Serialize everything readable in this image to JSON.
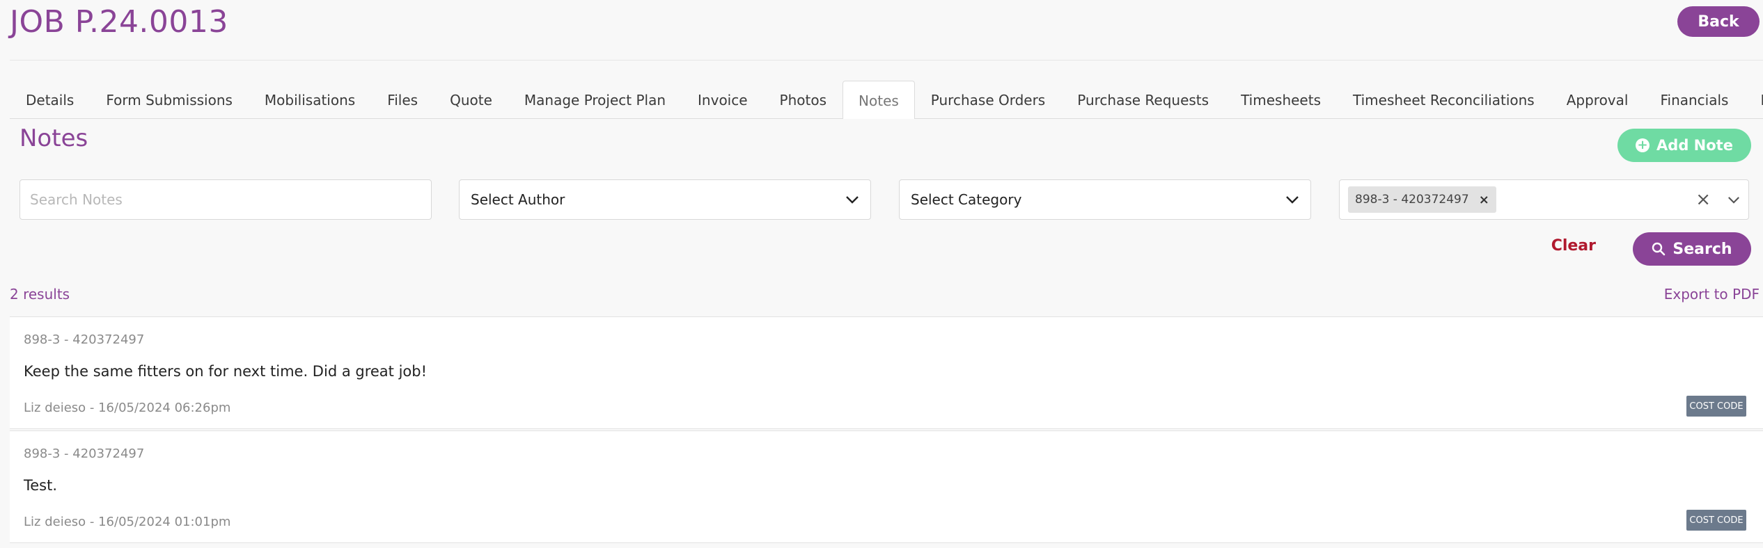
{
  "header": {
    "title": "JOB P.24.0013",
    "back_label": "Back"
  },
  "tabs": [
    {
      "label": "Details"
    },
    {
      "label": "Form Submissions"
    },
    {
      "label": "Mobilisations"
    },
    {
      "label": "Files"
    },
    {
      "label": "Quote"
    },
    {
      "label": "Manage Project Plan"
    },
    {
      "label": "Invoice"
    },
    {
      "label": "Photos"
    },
    {
      "label": "Notes",
      "active": true
    },
    {
      "label": "Purchase Orders"
    },
    {
      "label": "Purchase Requests"
    },
    {
      "label": "Timesheets"
    },
    {
      "label": "Timesheet Reconciliations"
    },
    {
      "label": "Approval"
    },
    {
      "label": "Financials"
    },
    {
      "label": "Receipts"
    }
  ],
  "notes_panel": {
    "heading": "Notes",
    "add_note_label": "Add Note",
    "filters": {
      "search_placeholder": "Search Notes",
      "search_value": "",
      "author_select": "Select Author",
      "category_select": "Select Category",
      "cost_code_chip": "898-3 - 420372497"
    },
    "clear_label": "Clear",
    "search_label": "Search",
    "results_count": "2 results",
    "export_label": "Export to PDF",
    "notes": [
      {
        "cost_code": "898-3 - 420372497",
        "text": "Keep the same fitters on for next time. Did a great job!",
        "meta": "Liz deieso - 16/05/2024 06:26pm",
        "badge": "COST CODE"
      },
      {
        "cost_code": "898-3 - 420372497",
        "text": "Test.",
        "meta": "Liz deieso - 16/05/2024 01:01pm",
        "badge": "COST CODE"
      }
    ]
  },
  "colors": {
    "brand_purple": "#8a4497",
    "add_green": "#6fdba3",
    "clear_red": "#b0192e",
    "badge_gray": "#6c7a8c"
  }
}
